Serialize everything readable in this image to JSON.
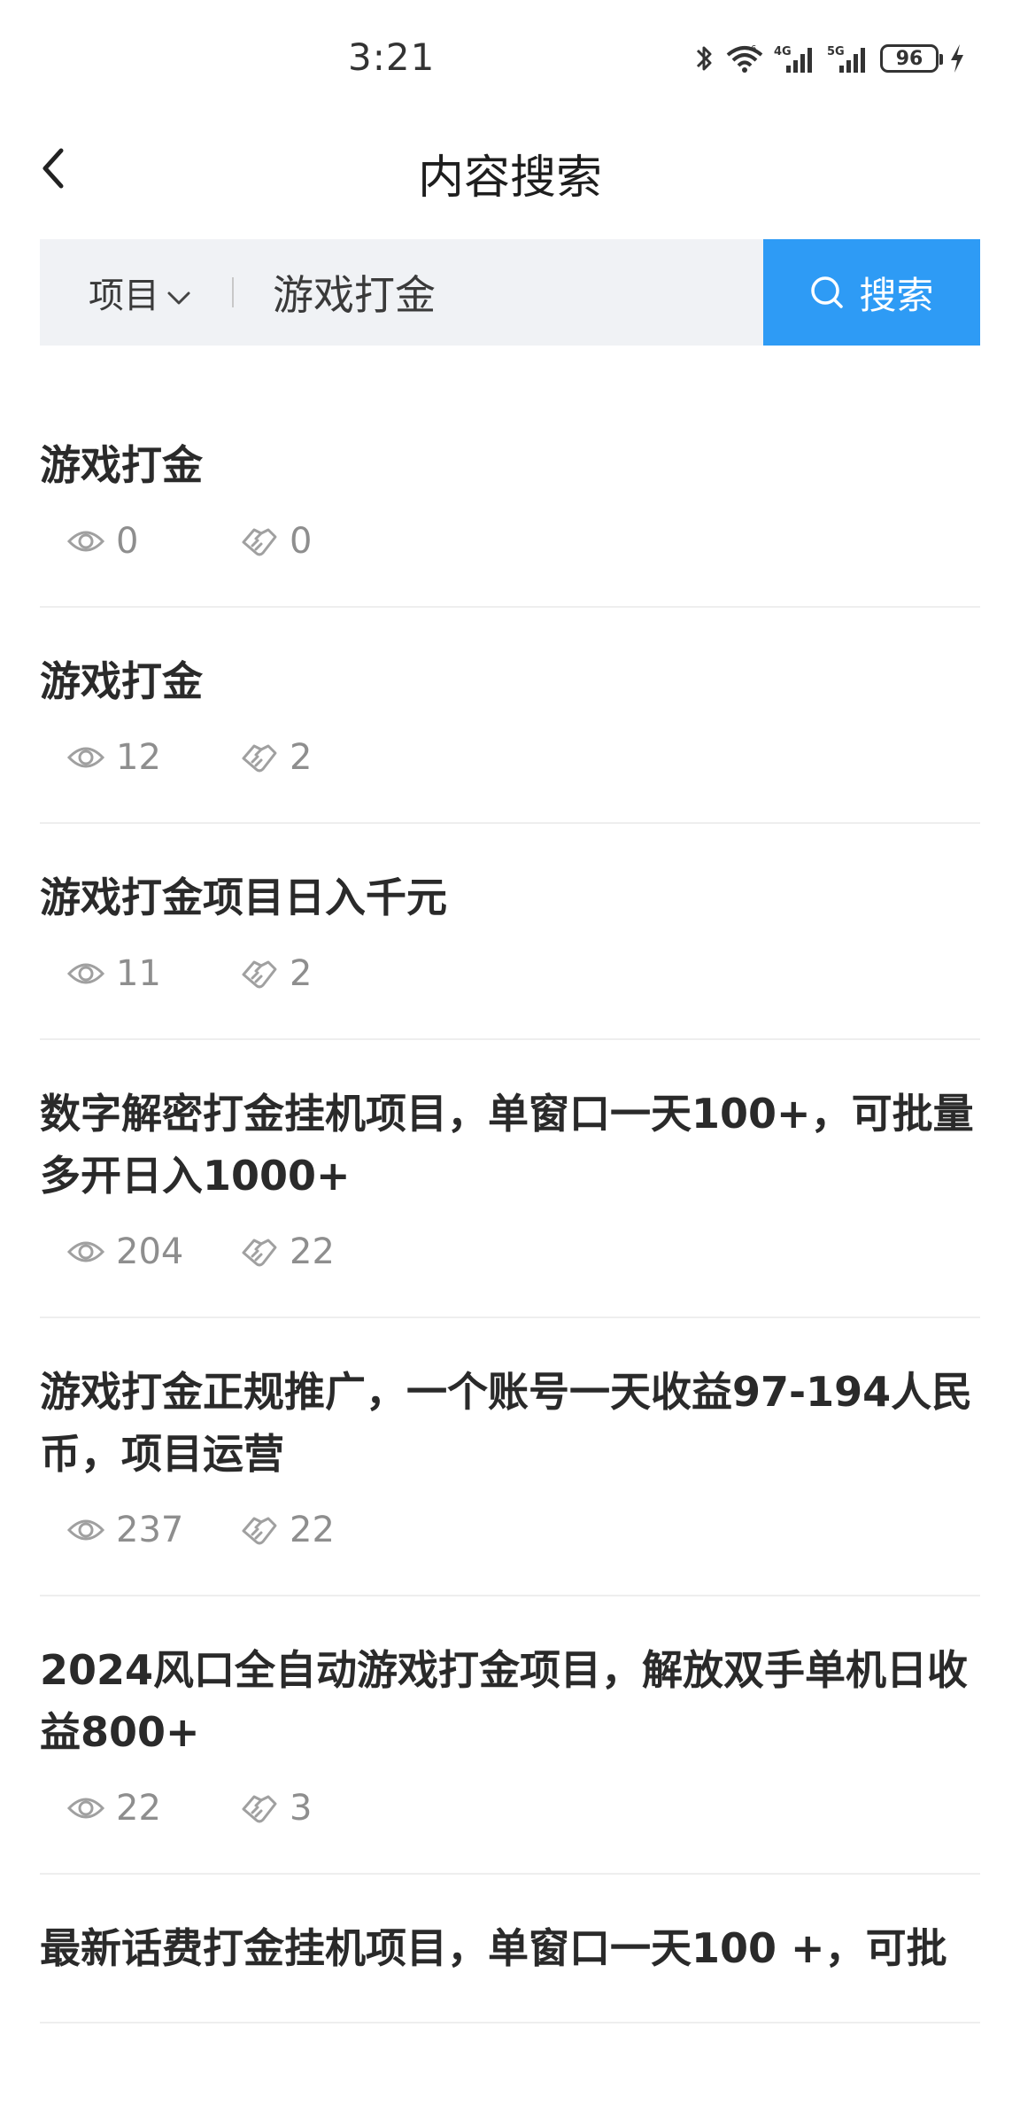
{
  "status_bar": {
    "time": "3:21",
    "battery": "96"
  },
  "header": {
    "title": "内容搜索"
  },
  "search": {
    "category": "项目",
    "query": "游戏打金",
    "button_label": "搜索"
  },
  "results": [
    {
      "title": "游戏打金",
      "views": "0",
      "likes": "0"
    },
    {
      "title": "游戏打金",
      "views": "12",
      "likes": "2"
    },
    {
      "title": "游戏打金项目日入千元",
      "views": "11",
      "likes": "2"
    },
    {
      "title": "数字解密打金挂机项目，单窗口一天100+，可批量多开日入1000+",
      "views": "204",
      "likes": "22"
    },
    {
      "title": "游戏打金正规推广，一个账号一天收益97-194人民币，项目运营",
      "views": "237",
      "likes": "22"
    },
    {
      "title": "2024风口全自动游戏打金项目，解放双手单机日收益800+",
      "views": "22",
      "likes": "3"
    },
    {
      "title": "最新话费打金挂机项目，单窗口一天100 +，可批",
      "views": "",
      "likes": ""
    }
  ],
  "colors": {
    "accent": "#2e9bf5",
    "search_bg": "#f0f2f5",
    "meta_text": "#8e8e8e"
  }
}
